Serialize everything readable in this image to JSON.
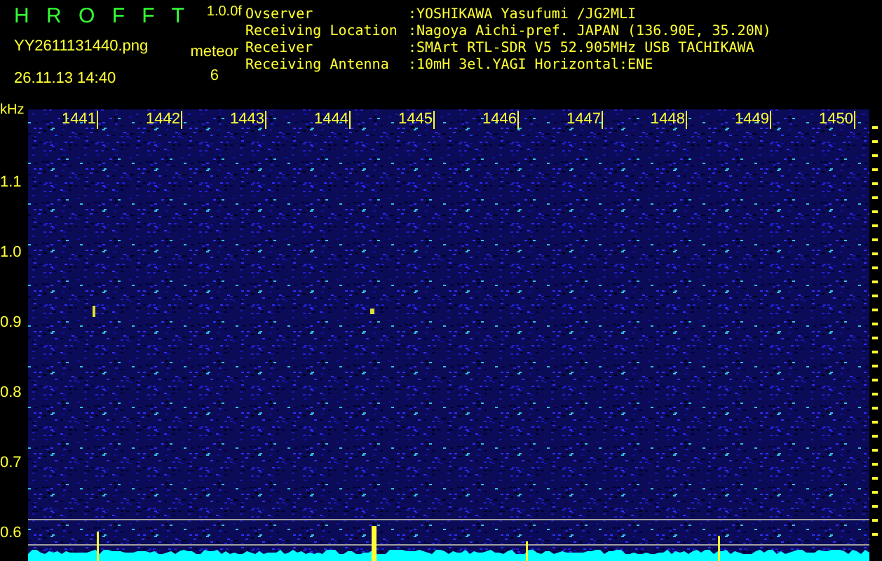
{
  "app": {
    "title": "H R O F F T",
    "version": "1.0.0f",
    "filename": "YY2611131440.png",
    "timestamp": "26.11.13 14:40",
    "mode_label": "meteor",
    "mode_count": "6"
  },
  "station_info": [
    {
      "label": "Ovserver",
      "value": ":YOSHIKAWA Yasufumi /JG2MLI"
    },
    {
      "label": "Receiving Location",
      "value": ":Nagoya Aichi-pref. JAPAN (136.90E, 35.20N)"
    },
    {
      "label": "Receiver",
      "value": ":SMArt RTL-SDR V5 52.905MHz USB TACHIKAWA"
    },
    {
      "label": "Receiving Antenna",
      "value": ":10mH 3el.YAGI Horizontal:ENE"
    }
  ],
  "spectrogram": {
    "y_unit": "kHz",
    "x_ticks": [
      "1441",
      "1442",
      "1443",
      "1444",
      "1445",
      "1446",
      "1447",
      "1448",
      "1449",
      "1450"
    ],
    "y_ticks": [
      "1.1",
      "1.0",
      "0.9",
      "0.8",
      "0.7",
      "0.6"
    ]
  }
}
